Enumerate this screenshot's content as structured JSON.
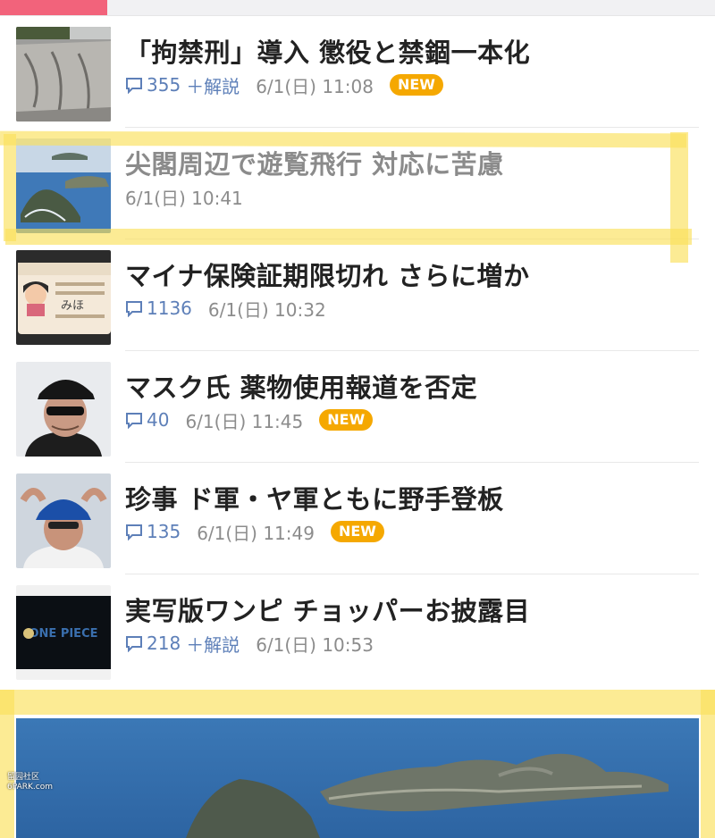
{
  "news": [
    {
      "title": "「拘禁刑」導入 懲役と禁錮一本化",
      "comments": "355",
      "kaisetsu": "＋解説",
      "date": "6/1(日) 11:08",
      "badge": "NEW"
    },
    {
      "title": "尖閣周辺で遊覧飛行 対応に苦慮",
      "comments": "",
      "kaisetsu": "",
      "date": "6/1(日) 10:41",
      "badge": ""
    },
    {
      "title": "マイナ保険証期限切れ さらに増か",
      "comments": "1136",
      "kaisetsu": "",
      "date": "6/1(日) 10:32",
      "badge": ""
    },
    {
      "title": "マスク氏 薬物使用報道を否定",
      "comments": "40",
      "kaisetsu": "",
      "date": "6/1(日) 11:45",
      "badge": "NEW"
    },
    {
      "title": "珍事 ド軍・ヤ軍ともに野手登板",
      "comments": "135",
      "kaisetsu": "",
      "date": "6/1(日) 11:49",
      "badge": "NEW"
    },
    {
      "title": "実写版ワンピ チョッパーお披露目",
      "comments": "218",
      "kaisetsu": "＋解説",
      "date": "6/1(日) 10:53",
      "badge": ""
    }
  ],
  "icons": {
    "comment": "comment-bubble-icon"
  },
  "thumb_text": {
    "card_name": "みほ",
    "onepiece_logo": "ONE PIECE"
  },
  "watermark": {
    "line1": "留园社区",
    "line2": "6PARK.com"
  },
  "colors": {
    "accent_tab": "#f2637b",
    "badge": "#f5a800",
    "comment_link": "#5d7fb8",
    "highlight": "#fae15a"
  }
}
